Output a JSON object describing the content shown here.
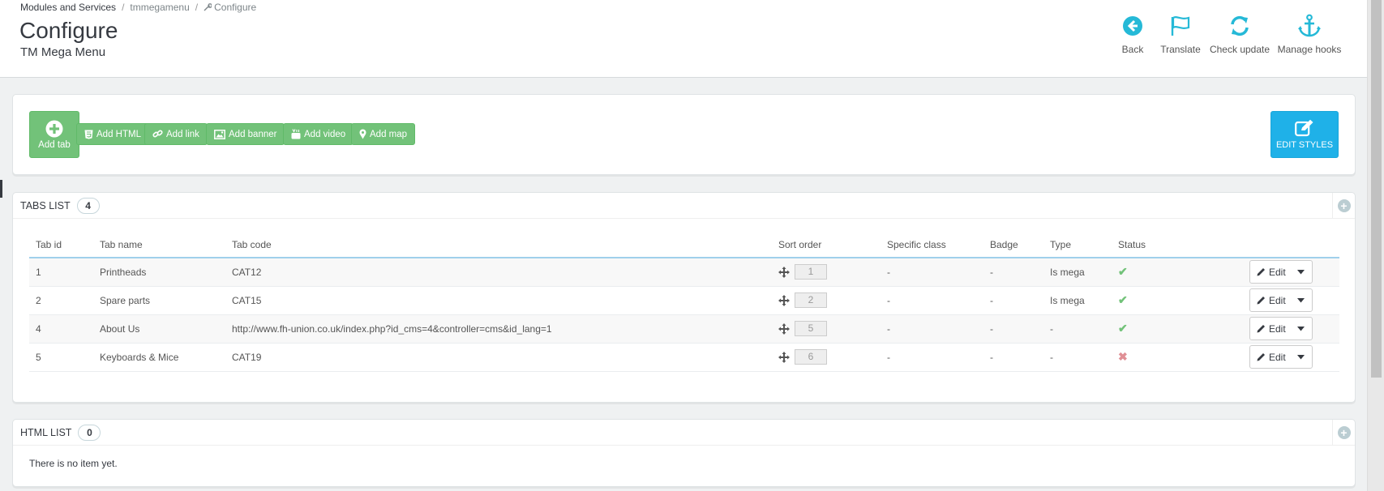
{
  "breadcrumb": {
    "items": [
      "Modules and Services",
      "tmmegamenu",
      "Configure"
    ],
    "separator": "/"
  },
  "header": {
    "title": "Configure",
    "subtitle": "TM Mega Menu"
  },
  "toolbar": [
    {
      "label": "Back",
      "icon": "back-circle-icon"
    },
    {
      "label": "Translate",
      "icon": "flag-icon"
    },
    {
      "label": "Check update",
      "icon": "refresh-icon"
    },
    {
      "label": "Manage hooks",
      "icon": "anchor-icon"
    }
  ],
  "actions": {
    "add_tab": "Add tab",
    "add_html": "Add HTML",
    "add_link": "Add link",
    "add_banner": "Add banner",
    "add_video": "Add video",
    "add_map": "Add map",
    "edit_styles": "EDIT STYLES"
  },
  "tabs_list": {
    "title": "TABS LIST",
    "count": "4",
    "columns": [
      "Tab id",
      "Tab name",
      "Tab code",
      "Sort order",
      "Specific class",
      "Badge",
      "Type",
      "Status"
    ],
    "rows": [
      {
        "id": "1",
        "name": "Printheads",
        "code": "CAT12",
        "sort": "1",
        "class": "-",
        "badge": "-",
        "type": "Is mega",
        "status": "enabled"
      },
      {
        "id": "2",
        "name": "Spare parts",
        "code": "CAT15",
        "sort": "2",
        "class": "-",
        "badge": "-",
        "type": "Is mega",
        "status": "enabled"
      },
      {
        "id": "4",
        "name": "About Us",
        "code": "http://www.fh-union.co.uk/index.php?id_cms=4&controller=cms&id_lang=1",
        "sort": "5",
        "class": "-",
        "badge": "-",
        "type": "-",
        "status": "enabled"
      },
      {
        "id": "5",
        "name": "Keyboards & Mice",
        "code": "CAT19",
        "sort": "6",
        "class": "-",
        "badge": "-",
        "type": "-",
        "status": "disabled"
      }
    ],
    "edit_label": "Edit"
  },
  "html_list": {
    "title": "HTML LIST",
    "count": "0",
    "empty_text": "There is no item yet."
  },
  "colors": {
    "accent_blue": "#25b9d7",
    "green": "#72c279",
    "edit_styles_blue": "#1fb1e8",
    "status_ok": "#72c279",
    "status_ko": "#e08f95"
  }
}
